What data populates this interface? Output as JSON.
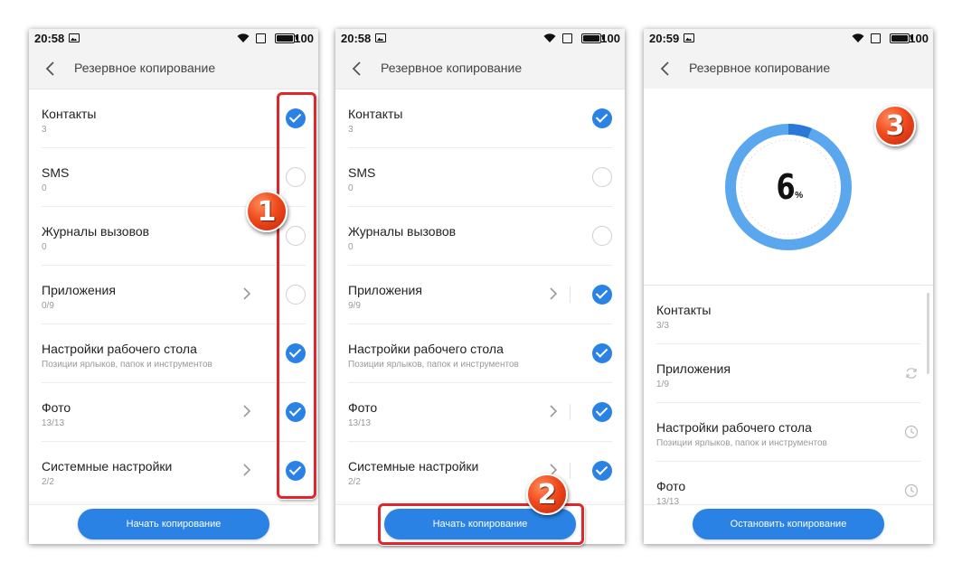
{
  "screens": [
    {
      "status": {
        "time": "20:58",
        "battery": "100"
      },
      "title": "Резервное копирование",
      "items": [
        {
          "title": "Контакты",
          "subtitle": "3",
          "checked": true,
          "chevron": false
        },
        {
          "title": "SMS",
          "subtitle": "0",
          "checked": false,
          "chevron": false
        },
        {
          "title": "Журналы вызовов",
          "subtitle": "0",
          "checked": false,
          "chevron": false
        },
        {
          "title": "Приложения",
          "subtitle": "0/9",
          "checked": false,
          "chevron": true
        },
        {
          "title": "Настройки рабочего стола",
          "subtitle": "Позиции ярлыков, папок и инструментов",
          "checked": true,
          "chevron": false
        },
        {
          "title": "Фото",
          "subtitle": "13/13",
          "checked": true,
          "chevron": true
        },
        {
          "title": "Системные настройки",
          "subtitle": "2/2",
          "checked": true,
          "chevron": true
        }
      ],
      "button": "Начать копирование"
    },
    {
      "status": {
        "time": "20:58",
        "battery": "100"
      },
      "title": "Резервное копирование",
      "items": [
        {
          "title": "Контакты",
          "subtitle": "3",
          "checked": true,
          "chevron": false
        },
        {
          "title": "SMS",
          "subtitle": "0",
          "checked": false,
          "chevron": false
        },
        {
          "title": "Журналы вызовов",
          "subtitle": "0",
          "checked": false,
          "chevron": false
        },
        {
          "title": "Приложения",
          "subtitle": "9/9",
          "checked": true,
          "chevron": true
        },
        {
          "title": "Настройки рабочего стола",
          "subtitle": "Позиции ярлыков, папок и инструментов",
          "checked": true,
          "chevron": false
        },
        {
          "title": "Фото",
          "subtitle": "13/13",
          "checked": true,
          "chevron": true
        },
        {
          "title": "Системные настройки",
          "subtitle": "2/2",
          "checked": true,
          "chevron": true
        }
      ],
      "button": "Начать копирование"
    },
    {
      "status": {
        "time": "20:59",
        "battery": "100"
      },
      "title": "Резервное копирование",
      "progress": {
        "value": "6",
        "unit": "%",
        "fraction": 0.06
      },
      "items": [
        {
          "title": "Контакты",
          "subtitle": "3/3",
          "state": "done"
        },
        {
          "title": "Приложения",
          "subtitle": "1/9",
          "state": "syncing-icon"
        },
        {
          "title": "Настройки рабочего стола",
          "subtitle": "Позиции ярлыков, папок и инструментов",
          "state": "clock-icon"
        },
        {
          "title": "Фото",
          "subtitle": "13/13",
          "state": "clock-icon"
        }
      ],
      "button": "Остановить копирование"
    }
  ],
  "annotations": {
    "badge_1": "1",
    "badge_2": "2",
    "badge_3": "3",
    "marker_color": "#e0262b"
  },
  "colors": {
    "accent": "#2a82e4",
    "ring_light": "#5aa7ee",
    "ring_dark": "#2a78d8",
    "badge": "#f04a1d"
  }
}
